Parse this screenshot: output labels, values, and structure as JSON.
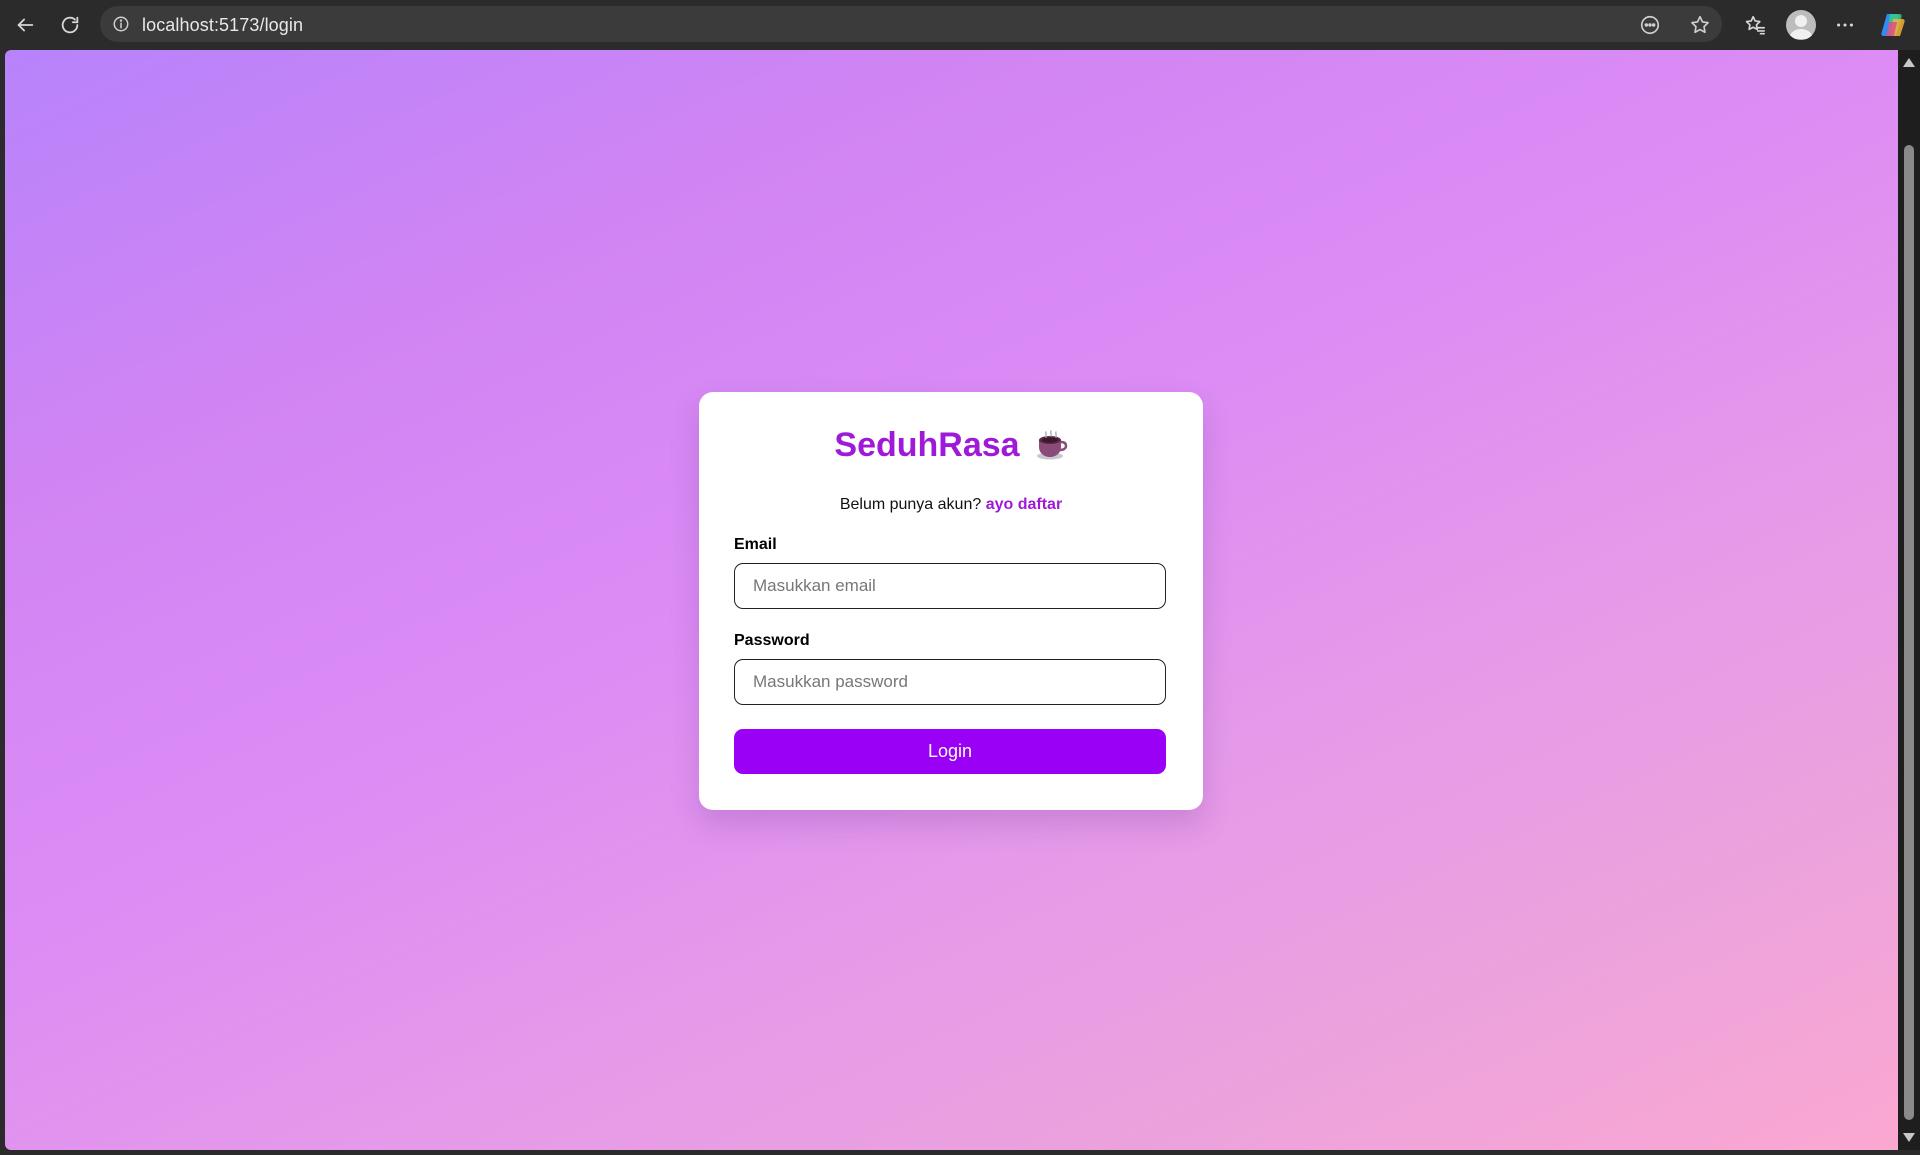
{
  "browser": {
    "url": "localhost:5173/login",
    "icons": {
      "back": "back-arrow-icon",
      "reload": "reload-icon",
      "site_info": "info-icon",
      "read_aloud": "read-aloud-icon",
      "favorite": "star-icon",
      "favorites_list": "favorites-icon",
      "profile": "profile-avatar-icon",
      "more": "more-icon",
      "copilot": "copilot-icon"
    }
  },
  "login": {
    "brand": "SeduhRasa",
    "brand_icon": "coffee-cup-icon",
    "signup_prompt": "Belum punya akun?",
    "signup_link": "ayo daftar",
    "email_label": "Email",
    "email_placeholder": "Masukkan email",
    "password_label": "Password",
    "password_placeholder": "Masukkan password",
    "login_button": "Login"
  },
  "colors": {
    "accent": "#9f1ad8",
    "button": "#9900f5",
    "gradient_start": "#b783fb",
    "gradient_end": "#fba8d2"
  }
}
